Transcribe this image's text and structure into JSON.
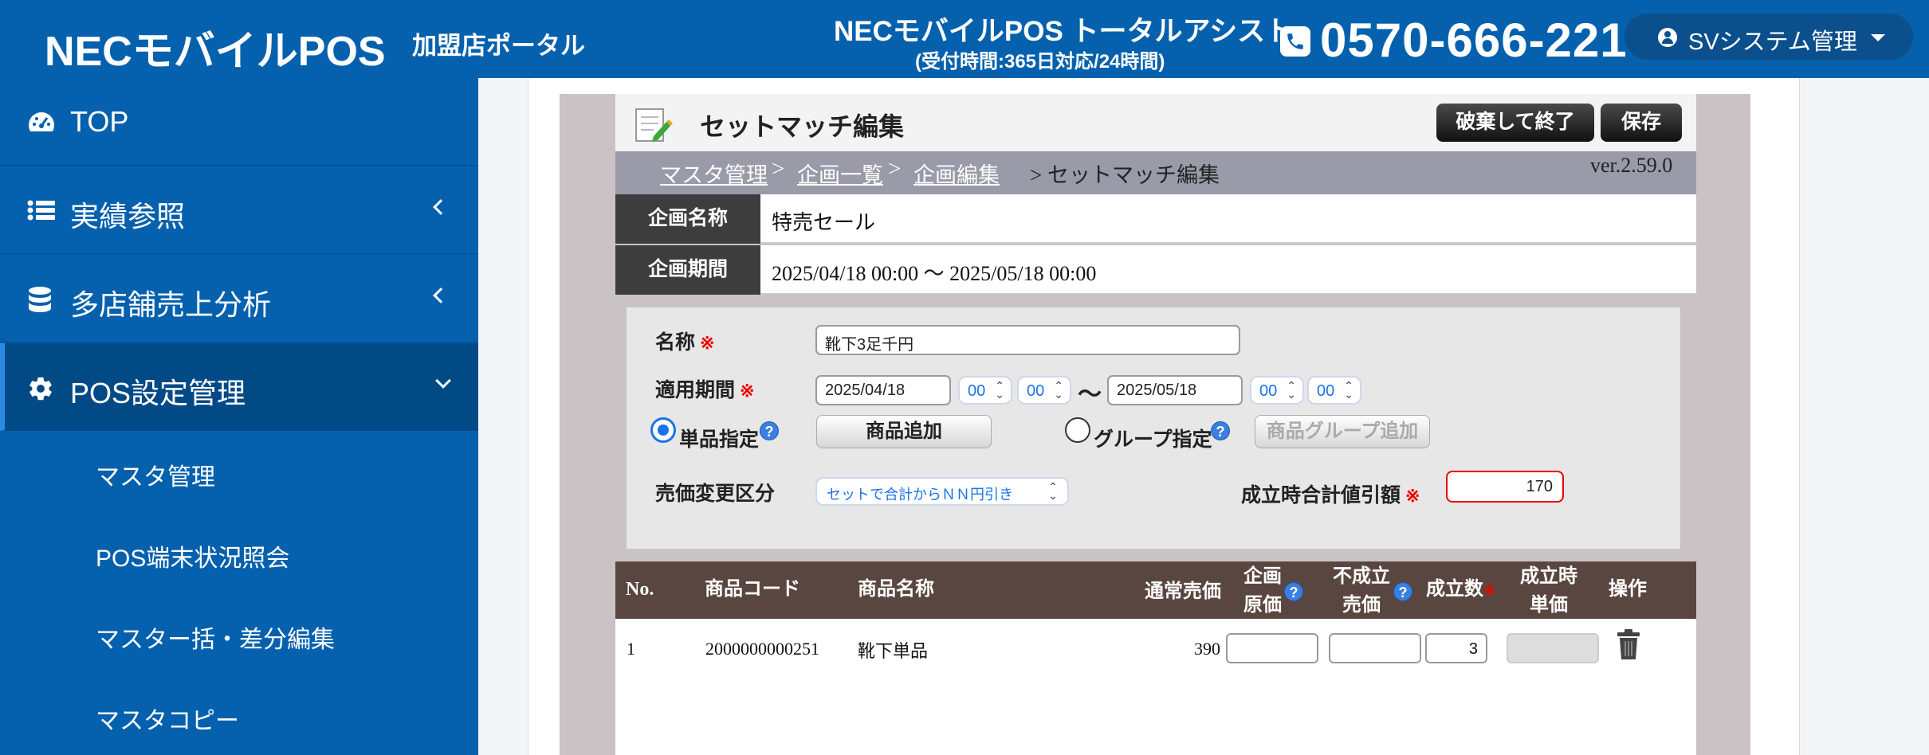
{
  "header": {
    "brand": "NECモバイルPOS",
    "portal": "加盟店ポータル",
    "assist_title": "NECモバイルPOS トータルアシスト",
    "assist_hours": "(受付時間:365日対応/24時間)",
    "phone": "0570-666-221",
    "user_menu": "SVシステム管理"
  },
  "sidebar": {
    "items": [
      {
        "label": "TOP",
        "icon": "dashboard-icon"
      },
      {
        "label": "実績参照",
        "icon": "list-icon"
      },
      {
        "label": "多店舗売上分析",
        "icon": "database-icon"
      },
      {
        "label": "POS設定管理",
        "icon": "gear-icon"
      }
    ],
    "subitems": [
      "マスタ管理",
      "POS端末状況照会",
      "マスター括・差分編集",
      "マスタコピー"
    ]
  },
  "page": {
    "title": "セットマッチ編集",
    "discard_button": "破棄して終了",
    "save_button": "保存",
    "breadcrumb": [
      "マスタ管理",
      "企画一覧",
      "企画編集"
    ],
    "breadcrumb_sep": ">",
    "breadcrumb_current": "> セットマッチ編集",
    "version": "ver.2.59.0"
  },
  "campaign": {
    "name_label": "企画名称",
    "name_value": "特売セール",
    "period_label": "企画期間",
    "period_value": "2025/04/18 00:00 〜 2025/05/18 00:00"
  },
  "form": {
    "name_label": "名称",
    "required_mark": "※",
    "name_value": "靴下3足千円",
    "period_label": "適用期間",
    "start_date": "2025/04/18",
    "start_hour": "00",
    "start_min": "00",
    "tilde": "〜",
    "end_date": "2025/05/18",
    "end_hour": "00",
    "end_min": "00",
    "single_label": "単品指定",
    "add_item_button": "商品追加",
    "group_label": "グループ指定",
    "add_group_button": "商品グループ追加",
    "price_change_label": "売価変更区分",
    "price_change_value": "セットで合計からＮＮ円引き",
    "discount_label": "成立時合計値引額",
    "discount_value": "170",
    "help_glyph": "?"
  },
  "table": {
    "headers": {
      "no": "No.",
      "code": "商品コード",
      "name": "商品名称",
      "price": "通常売価",
      "cost_1": "企画",
      "cost_2": "原価",
      "fail_1": "不成立",
      "fail_2": "売価",
      "count": "成立数",
      "unit_1": "成立時",
      "unit_2": "単価",
      "ops": "操作"
    },
    "rows": [
      {
        "no": "1",
        "code": "2000000000251",
        "name": "靴下単品",
        "price": "390",
        "cost": "",
        "fail_price": "",
        "count": "3",
        "unit_price": ""
      }
    ]
  },
  "colors": {
    "header_bg": "#0561ad",
    "sidebar_active": "#024a86",
    "table_head": "#5a4640",
    "accent": "#1a73e8"
  }
}
